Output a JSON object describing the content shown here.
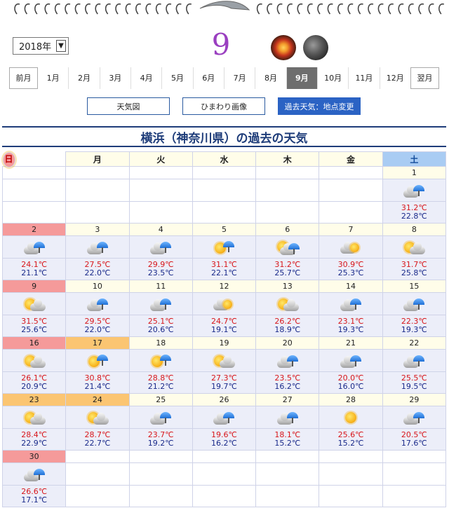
{
  "header": {
    "year_select": "2018年",
    "month_number": "9"
  },
  "nav": {
    "prev_label": "前月",
    "next_label": "翌月",
    "months": [
      "1月",
      "2月",
      "3月",
      "4月",
      "5月",
      "6月",
      "7月",
      "8月",
      "9月",
      "10月",
      "11月",
      "12月"
    ],
    "active_month_index": 8
  },
  "buttons": {
    "weather_map": "天気図",
    "himawari": "ひまわり画像",
    "past_weather": "過去天気：地点変更"
  },
  "title": "横浜（神奈川県）の過去の天気",
  "weekdays": [
    "日",
    "月",
    "火",
    "水",
    "木",
    "金",
    "土"
  ],
  "colors": {
    "high_temp": "#d8171b",
    "low_temp": "#1a2a8a",
    "sunday_header": "#f59a9a",
    "saturday_header": "#a9ccf3",
    "holiday_orange": "#fbc572"
  },
  "weeks": [
    {
      "days": [
        null,
        null,
        null,
        null,
        null,
        null,
        {
          "day": "1",
          "weather": "cloud-rain-icon",
          "high": "31.2℃",
          "low": "22.8℃"
        }
      ]
    },
    {
      "days": [
        {
          "day": "2",
          "weather": "cloud-rain-icon",
          "high": "24.1℃",
          "low": "21.1℃",
          "holiday": "sun"
        },
        {
          "day": "3",
          "weather": "cloud-rain-icon",
          "high": "27.5℃",
          "low": "22.0℃"
        },
        {
          "day": "4",
          "weather": "cloud-rain-icon",
          "high": "29.9℃",
          "low": "23.5℃"
        },
        {
          "day": "5",
          "weather": "sun-rain-icon",
          "high": "31.1℃",
          "low": "22.1℃"
        },
        {
          "day": "6",
          "weather": "sun-cloud-rain-icon",
          "high": "31.2℃",
          "low": "25.7℃"
        },
        {
          "day": "7",
          "weather": "cloud-sun-icon",
          "high": "30.9℃",
          "low": "25.3℃"
        },
        {
          "day": "8",
          "weather": "sun-cloud-icon",
          "high": "31.7℃",
          "low": "25.8℃"
        }
      ]
    },
    {
      "days": [
        {
          "day": "9",
          "weather": "sun-cloud-icon",
          "high": "31.5℃",
          "low": "25.6℃",
          "holiday": "sun"
        },
        {
          "day": "10",
          "weather": "cloud-rain-icon",
          "high": "29.5℃",
          "low": "22.0℃"
        },
        {
          "day": "11",
          "weather": "cloud-rain-icon",
          "high": "25.1℃",
          "low": "20.6℃"
        },
        {
          "day": "12",
          "weather": "cloud-sun-icon",
          "high": "24.7℃",
          "low": "19.1℃"
        },
        {
          "day": "13",
          "weather": "sun-cloud-icon",
          "high": "26.2℃",
          "low": "18.9℃"
        },
        {
          "day": "14",
          "weather": "cloud-rain-icon",
          "high": "23.1℃",
          "low": "19.3℃"
        },
        {
          "day": "15",
          "weather": "cloud-rain-icon",
          "high": "22.3℃",
          "low": "19.3℃"
        }
      ]
    },
    {
      "days": [
        {
          "day": "16",
          "weather": "sun-cloud-icon",
          "high": "26.1℃",
          "low": "20.9℃",
          "holiday": "sun"
        },
        {
          "day": "17",
          "weather": "sun-rain-icon",
          "high": "30.8℃",
          "low": "21.4℃",
          "holiday": "holiday"
        },
        {
          "day": "18",
          "weather": "sun-rain-icon",
          "high": "28.8℃",
          "low": "21.2℃"
        },
        {
          "day": "19",
          "weather": "sun-cloud-icon",
          "high": "27.3℃",
          "low": "19.7℃"
        },
        {
          "day": "20",
          "weather": "cloud-rain-icon",
          "high": "23.5℃",
          "low": "16.2℃"
        },
        {
          "day": "21",
          "weather": "cloud-rain-icon",
          "high": "20.0℃",
          "low": "16.0℃"
        },
        {
          "day": "22",
          "weather": "cloud-rain-icon",
          "high": "25.5℃",
          "low": "19.5℃"
        }
      ]
    },
    {
      "days": [
        {
          "day": "23",
          "weather": "sun-cloud-icon",
          "high": "28.4℃",
          "low": "22.9℃",
          "holiday": "holiday"
        },
        {
          "day": "24",
          "weather": "sun-cloud-icon",
          "high": "28.7℃",
          "low": "22.7℃",
          "holiday": "holiday"
        },
        {
          "day": "25",
          "weather": "cloud-rain-icon",
          "high": "23.7℃",
          "low": "19.2℃"
        },
        {
          "day": "26",
          "weather": "cloud-rain-icon",
          "high": "19.6℃",
          "low": "16.2℃"
        },
        {
          "day": "27",
          "weather": "cloud-rain-icon",
          "high": "18.1℃",
          "low": "15.2℃"
        },
        {
          "day": "28",
          "weather": "sun-icon",
          "high": "25.6℃",
          "low": "15.2℃"
        },
        {
          "day": "29",
          "weather": "cloud-rain-icon",
          "high": "20.5℃",
          "low": "17.6℃"
        }
      ]
    },
    {
      "days": [
        {
          "day": "30",
          "weather": "cloud-rain-icon",
          "high": "26.6℃",
          "low": "17.1℃",
          "holiday": "sun"
        },
        null,
        null,
        null,
        null,
        null,
        null
      ]
    }
  ]
}
